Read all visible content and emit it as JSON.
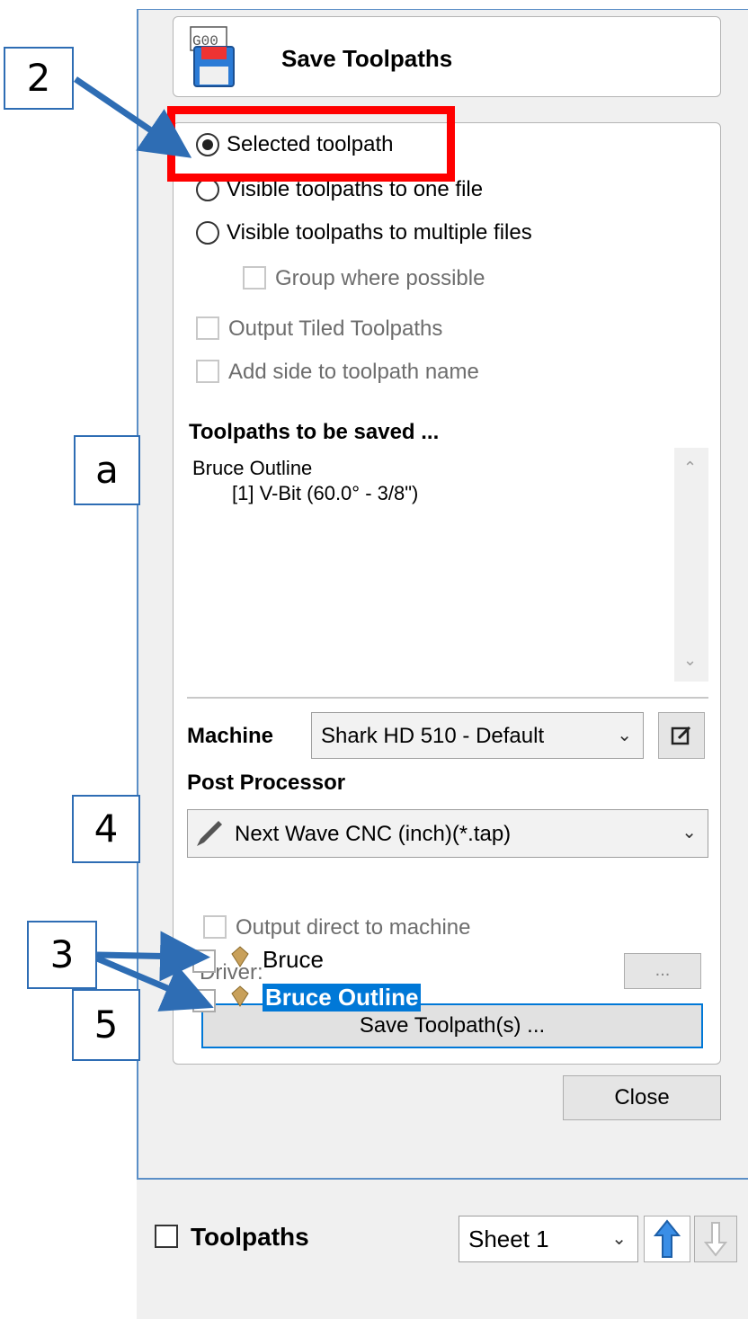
{
  "header": {
    "title": "Save Toolpaths",
    "icon_text": "G00"
  },
  "options": {
    "radio_selected": "Selected toolpath",
    "radio_one_file": "Visible toolpaths to one file",
    "radio_multiple": "Visible toolpaths to multiple files",
    "group_possible": "Group where possible",
    "output_tiled": "Output Tiled Toolpaths",
    "add_side": "Add side to toolpath name"
  },
  "toolpaths_list": {
    "heading": "Toolpaths to be saved ...",
    "items": [
      "Bruce Outline",
      "[1] V-Bit (60.0° - 3/8\")"
    ]
  },
  "machine": {
    "label": "Machine",
    "value": "Shark HD 510 - Default"
  },
  "post_processor": {
    "label": "Post Processor",
    "value": "Next Wave CNC (inch)(*.tap)"
  },
  "output_direct": "Output direct to machine",
  "driver": {
    "label": "Driver:",
    "button": "..."
  },
  "save_button": "Save Toolpath(s) ...",
  "close_button": "Close",
  "toolpaths_panel": {
    "title": "Toolpaths",
    "sheet": "Sheet 1",
    "tree": [
      "Bruce",
      "Bruce Outline"
    ]
  },
  "annotations": [
    "2",
    "a",
    "4",
    "5",
    "3"
  ],
  "colors": {
    "highlight": "#ff0000",
    "annotation": "#2e6db4",
    "selection": "#0078d7"
  }
}
